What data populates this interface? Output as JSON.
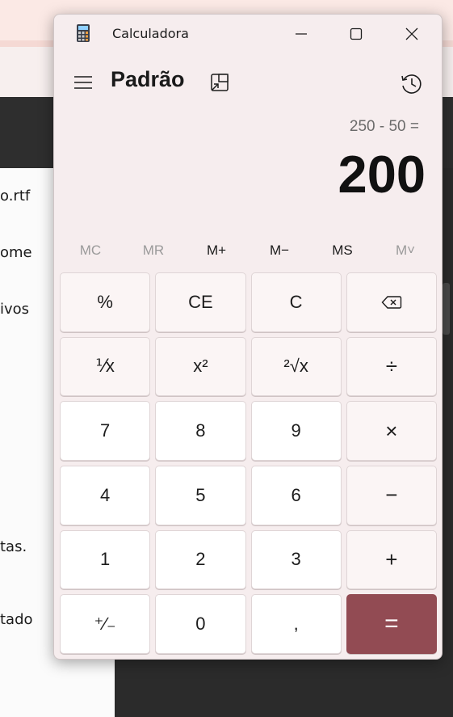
{
  "background": {
    "fragments": [
      "o.rtf",
      "ome",
      "ivos",
      "tas.",
      "tado"
    ]
  },
  "window": {
    "title": "Calculadora"
  },
  "header": {
    "mode": "Padrão"
  },
  "display": {
    "expression": "250 - 50 =",
    "value": "200"
  },
  "memory": [
    "MC",
    "MR",
    "M+",
    "M−",
    "MS",
    "M˅"
  ],
  "keys": {
    "percent": "%",
    "ce": "CE",
    "c": "C",
    "reciprocal": "⅟x",
    "square": "x²",
    "sqrt": "²√x",
    "divide": "÷",
    "seven": "7",
    "eight": "8",
    "nine": "9",
    "multiply": "×",
    "four": "4",
    "five": "5",
    "six": "6",
    "minus": "−",
    "one": "1",
    "two": "2",
    "three": "3",
    "plus": "+",
    "negate": "⁺∕₋",
    "zero": "0",
    "decimal": ",",
    "equals": "="
  },
  "colors": {
    "accent": "#924b53",
    "window_bg": "#f6edee"
  }
}
